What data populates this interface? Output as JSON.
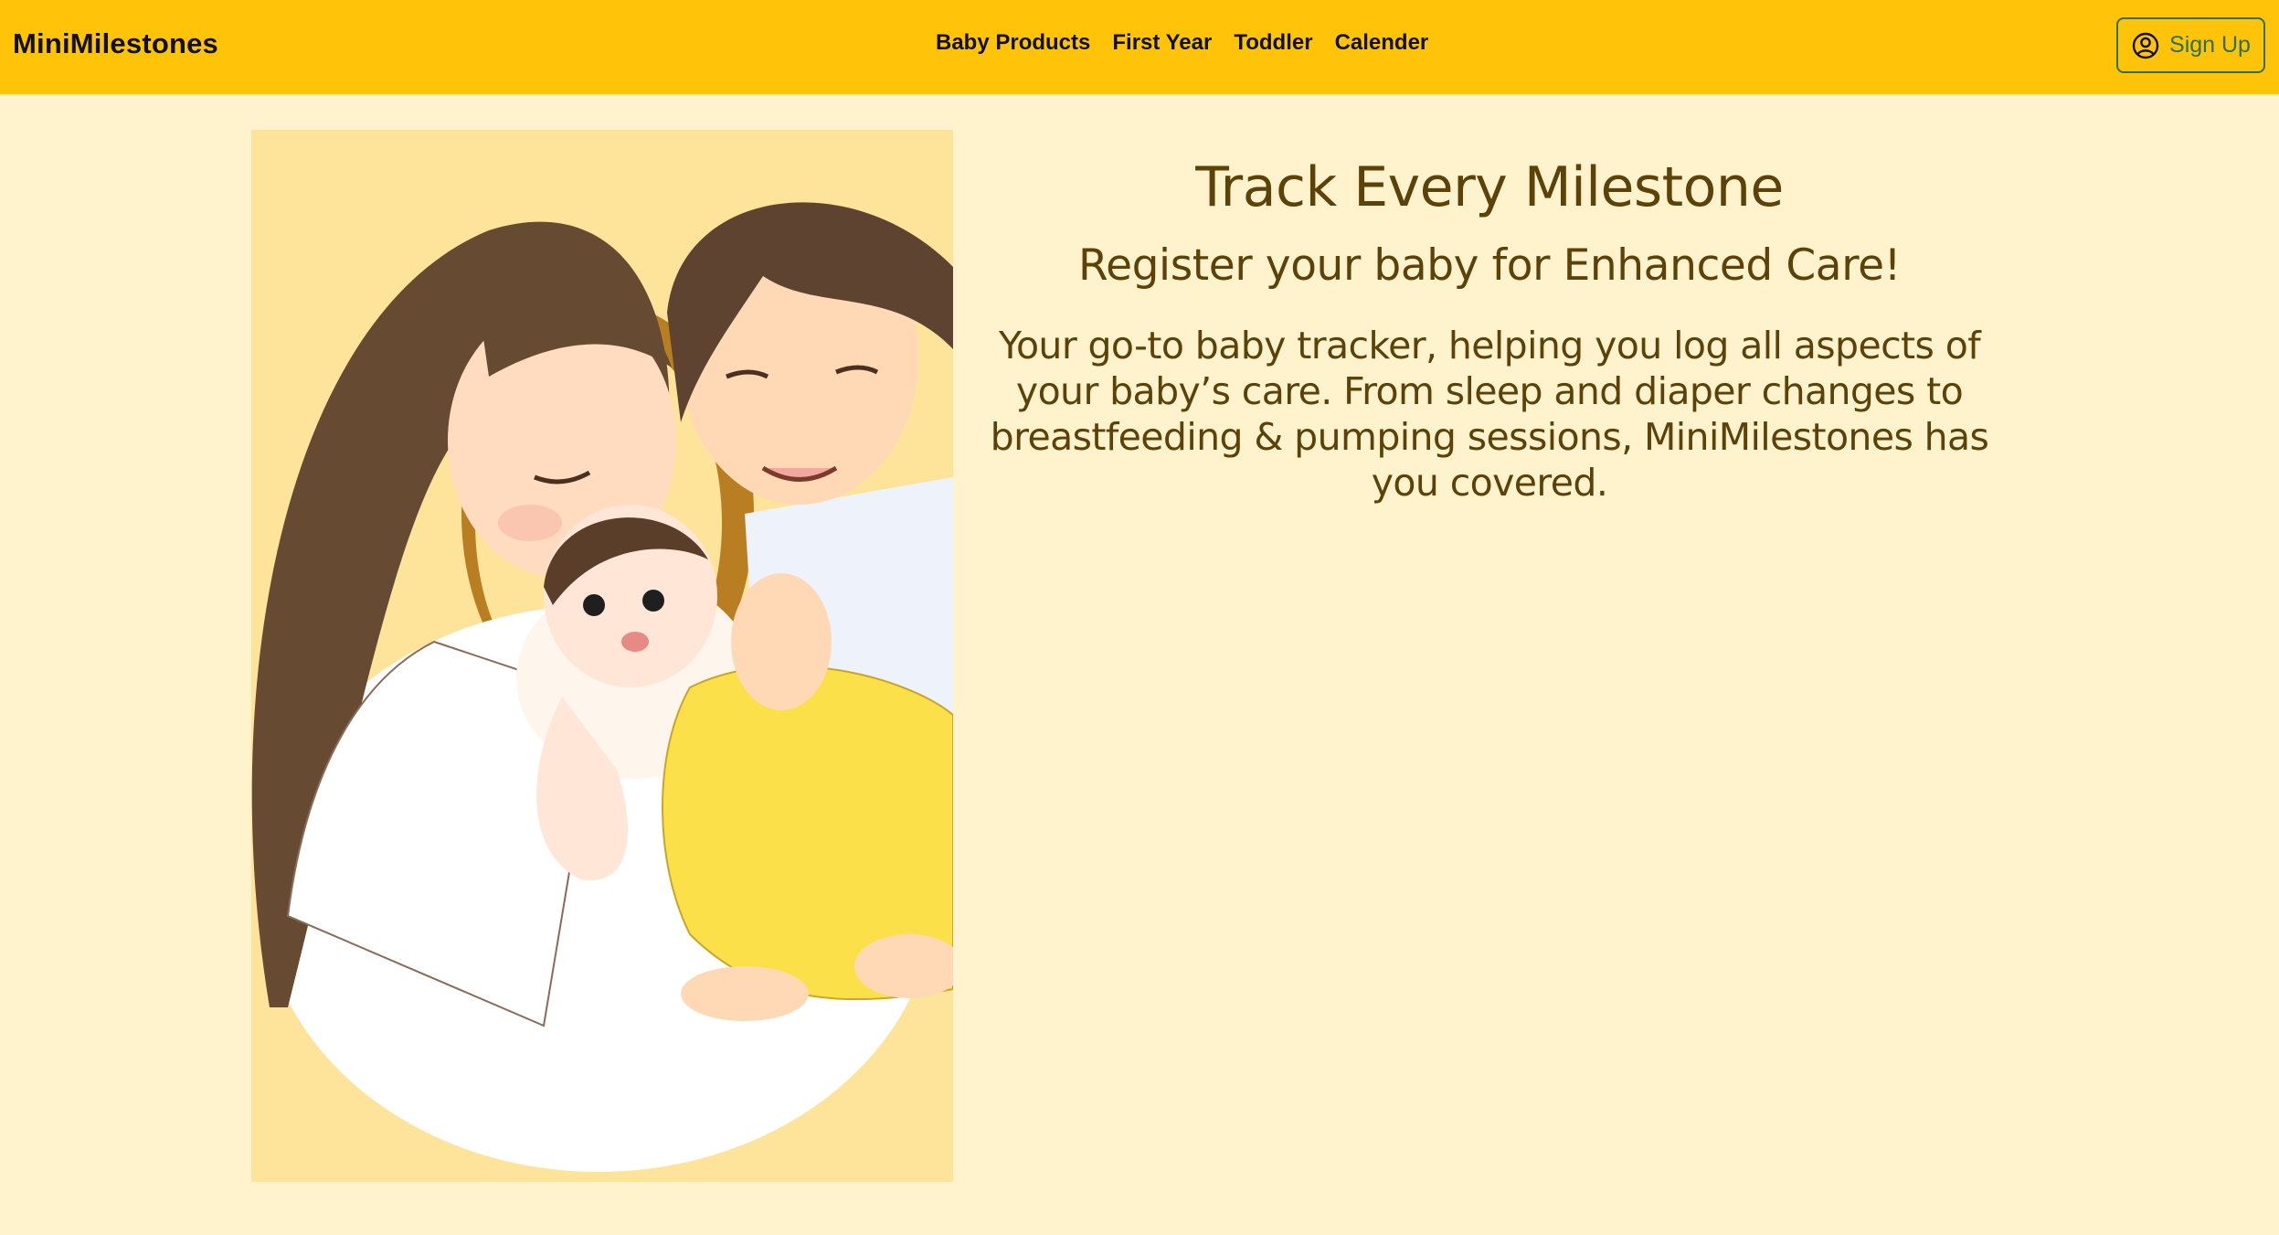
{
  "navbar": {
    "brand": "MiniMilestones",
    "links": [
      {
        "label": "Baby Products"
      },
      {
        "label": "First Year"
      },
      {
        "label": "Toddler"
      },
      {
        "label": "Calender"
      }
    ],
    "signup_label": "Sign Up",
    "signup_icon": "user-circle-icon"
  },
  "hero": {
    "title": "Track Every Milestone",
    "subtitle": "Register your baby for Enhanced Care!",
    "description": "Your go-to baby tracker, helping you log all aspects of your baby’s care. From sleep and diaper changes to breastfeeding & pumping sessions, MiniMilestones has you covered."
  },
  "colors": {
    "navbar_bg": "#FFC40A",
    "page_bg": "#FEF3CD",
    "text_brown": "#5C4108",
    "signup_green": "#2F6F4A"
  }
}
